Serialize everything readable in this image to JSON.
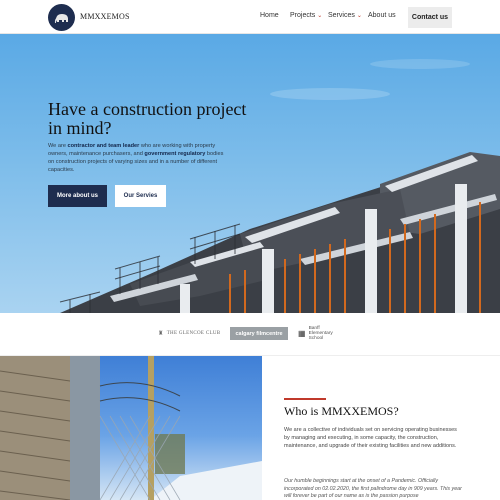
{
  "brand": {
    "name": "MMXXEMOS",
    "logo_icon": "elephant-emblem-icon",
    "logo_color": "#1e2d4f"
  },
  "nav": {
    "items": [
      {
        "label": "Home",
        "has_dropdown": false
      },
      {
        "label": "Projects",
        "has_dropdown": true
      },
      {
        "label": "Services",
        "has_dropdown": true
      },
      {
        "label": "About us",
        "has_dropdown": false
      }
    ],
    "cta": "Contact us"
  },
  "hero": {
    "title": "Have a construction project in mind?",
    "intro_1": "We are ",
    "intro_bold_1": "contractor and team leader",
    "intro_2": " who are working with property owners, maintenance purchasers, and ",
    "intro_bold_2": "government regulatory",
    "intro_3": " bodies on construction projects of varying sizes and in a number of different capacities.",
    "primary_button": "More about us",
    "secondary_button": "Our Servies"
  },
  "clients": {
    "glencoe": "THE GLENCOE CLUB",
    "calgary": "calgary filmcentre",
    "banff": "Banff Elementary School"
  },
  "about": {
    "title": "Who is MMXXEMOS?",
    "text": "We are a collective of individuals set on servicing operating businesses by managing and executing, in some capacity, the construction, maintenance, and upgrade of their existing facilities and new additions.",
    "story": "Our humble beginnings start at the onset of a Pandemic. Officially incorporated on 02.02.2020, the first palindrome day in 909 years. This year will forever be part of our name as is the passion purpose"
  },
  "colors": {
    "primary": "#1e2d4f",
    "accent": "#c0392b",
    "sky": "#5aa9e5"
  }
}
